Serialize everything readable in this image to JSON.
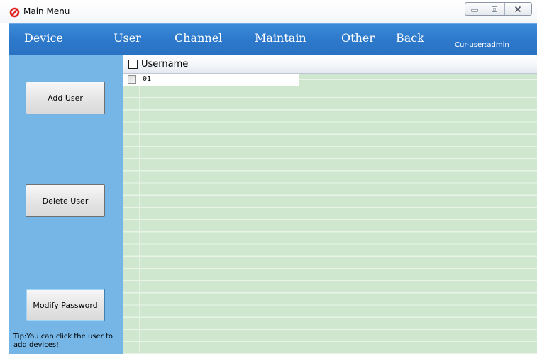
{
  "window": {
    "title": "Main Menu",
    "icon": "app-logo-icon",
    "controls": [
      "minimize-icon",
      "restore-icon",
      "close-icon"
    ]
  },
  "menu": {
    "items": [
      {
        "label": "Device"
      },
      {
        "label": "User"
      },
      {
        "label": "Channel"
      },
      {
        "label": "Maintain"
      },
      {
        "label": "Other"
      },
      {
        "label": "Back"
      }
    ],
    "current_user": "Cur-user:admin"
  },
  "sidebar": {
    "buttons": [
      {
        "label": "Add User"
      },
      {
        "label": "Delete User"
      },
      {
        "label": "Modify Password"
      }
    ],
    "tip": "Tip:You can click the user to add devices!"
  },
  "table": {
    "columns": [
      "Username"
    ],
    "rows": [
      {
        "username": "01",
        "checked": false
      }
    ]
  },
  "colors": {
    "menu_bar": "#2d79cc",
    "sidebar": "#75b6e6",
    "grid": "#cfe7cf"
  }
}
